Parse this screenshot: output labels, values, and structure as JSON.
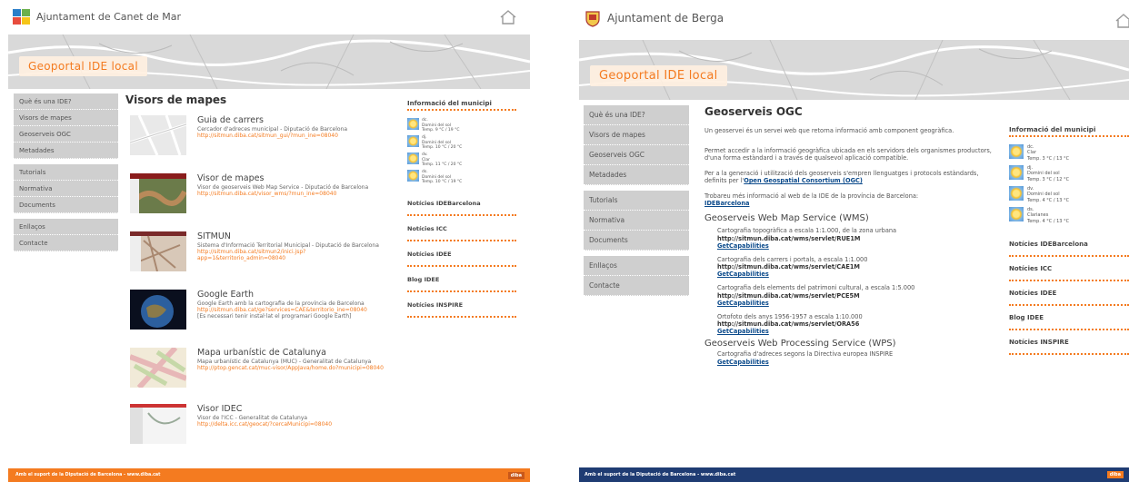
{
  "colors": {
    "accent": "#f47b20",
    "nav_bg": "#cfcfcf",
    "link": "#0b4a8b",
    "footer": "#f47b20"
  },
  "left": {
    "municipality": "Ajuntament de Canet de Mar",
    "banner_title": "Geoportal IDE local",
    "nav_groups": [
      [
        "Què és una IDE?",
        "Visors de mapes",
        "Geoserveis OGC",
        "Metadades"
      ],
      [
        "Tutorials",
        "Normativa",
        "Documents"
      ],
      [
        "Enllaços",
        "Contacte"
      ]
    ],
    "content_title": "Visors de mapes",
    "viewers": [
      {
        "title": "Guia de carrers",
        "desc": "Cercador d'adreces municipal - Diputació de Barcelona",
        "link": "http://sitmun.diba.cat/sitmun_gui/?mun_ine=08040",
        "note": ""
      },
      {
        "title": "Visor de mapes",
        "desc": "Visor de geoserveis Web Map Service - Diputació de Barcelona",
        "link": "http://sitmun.diba.cat/visor_wms/?mun_ine=08040",
        "note": ""
      },
      {
        "title": "SITMUN",
        "desc": "Sistema d'Informació Territorial Municipal - Diputació de Barcelona",
        "link": "http://sitmun.diba.cat/sitmun2/inici.jsp?app=1&territorio_admin=08040",
        "note": ""
      },
      {
        "title": "Google Earth",
        "desc": "Google Earth amb la cartografia de la província de Barcelona",
        "link": "http://sitmun.diba.cat/ge?services=CAE&territorio_ine=08040",
        "note": "[Es necessari tenir instal·lat el programari Google Earth]"
      },
      {
        "title": "Mapa urbanístic de Catalunya",
        "desc": "Mapa urbanístic de Catalunya (MUC) - Generalitat de Catalunya",
        "link": "http://ptop.gencat.cat/muc-visor/AppJava/home.do?municipi=08040",
        "note": ""
      },
      {
        "title": "Visor IDEC",
        "desc": "Visor de l'ICC - Generalitat de Catalunya",
        "link": "http://delta.icc.cat/geocat/?cercaMunicipi=08040",
        "note": ""
      }
    ],
    "side_title": "Informació del municipi",
    "weather": [
      {
        "day": "dc.",
        "state": "Domini del sol",
        "temp": "Temp. 9 °C / 19 °C"
      },
      {
        "day": "dj.",
        "state": "Domini del sol",
        "temp": "Temp. 10 °C / 20 °C"
      },
      {
        "day": "dv.",
        "state": "Clar",
        "temp": "Temp. 11 °C / 20 °C"
      },
      {
        "day": "ds.",
        "state": "Domini del sol",
        "temp": "Temp. 10 °C / 19 °C"
      }
    ],
    "news": [
      "Notícies IDEBarcelona",
      "Notícies ICC",
      "Notícies IDEE",
      "Blog IDEE",
      "Notícies INSPIRE"
    ],
    "footer": "Amb el suport de la Diputació de Barcelona - www.diba.cat",
    "footer_logo": "diba"
  },
  "right": {
    "municipality": "Ajuntament de Berga",
    "banner_title": "Geoportal IDE local",
    "nav_groups": [
      [
        "Què és una IDE?",
        "Visors de mapes",
        "Geoserveis OGC",
        "Metadades"
      ],
      [
        "Tutorials",
        "Normativa",
        "Documents"
      ],
      [
        "Enllaços",
        "Contacte"
      ]
    ],
    "content_title": "Geoserveis OGC",
    "intro1": "Un geoservei és un servei web que retorna informació amb component geogràfica.",
    "intro2": "Permet accedir a la informació geogràfica ubicada en els servidors dels organismes productors, d'una forma estàndard i a través de qualsevol aplicació compatible.",
    "intro3a": "Per a la generació i utilització dels geoserveis s'empren llenguatges i protocols estàndards, definits per l'",
    "intro3_link": "Open Geospatial Consortium (OGC)",
    "intro4": "Trobareu més informació al web de la IDE de la província de Barcelona:",
    "intro4_link": "IDEBarcelona",
    "wms_title": "Geoserveis Web Map Service (WMS)",
    "wms": [
      {
        "desc": "Cartografia topogràfica a escala 1:1.000, de la zona urbana",
        "url": "http://sitmun.diba.cat/wms/servlet/RUE1M",
        "gc": "GetCapabilities"
      },
      {
        "desc": "Cartografia dels carrers i portals, a escala 1:1.000",
        "url": "http://sitmun.diba.cat/wms/servlet/CAE1M",
        "gc": "GetCapabilities"
      },
      {
        "desc": "Cartografia dels elements del patrimoni cultural, a escala 1:5.000",
        "url": "http://sitmun.diba.cat/wms/servlet/PCE5M",
        "gc": "GetCapabilities"
      },
      {
        "desc": "Ortofoto dels anys 1956-1957 a escala 1:10.000",
        "url": "http://sitmun.diba.cat/wms/servlet/ORA56",
        "gc": "GetCapabilities"
      }
    ],
    "wps_title": "Geoserveis Web Processing Service (WPS)",
    "wps": [
      {
        "desc": "Cartografia d'adreces segons la Directiva europea INSPIRE",
        "gc": "GetCapabilities"
      }
    ],
    "side_title": "Informació del municipi",
    "weather": [
      {
        "day": "dc.",
        "state": "Clar",
        "temp": "Temp. 3 °C / 13 °C"
      },
      {
        "day": "dj.",
        "state": "Domini del sol",
        "temp": "Temp. 3 °C / 12 °C"
      },
      {
        "day": "dv.",
        "state": "Domini del sol",
        "temp": "Temp. 4 °C / 13 °C"
      },
      {
        "day": "ds.",
        "state": "Clarianes",
        "temp": "Temp. 4 °C / 13 °C"
      }
    ],
    "news": [
      "Notícies IDEBarcelona",
      "Notícies ICC",
      "Notícies IDEE",
      "Blog IDEE",
      "Notícies INSPIRE"
    ],
    "footer": "Amb el suport de la Diputació de Barcelona - www.diba.cat",
    "footer_logo": "diba"
  }
}
